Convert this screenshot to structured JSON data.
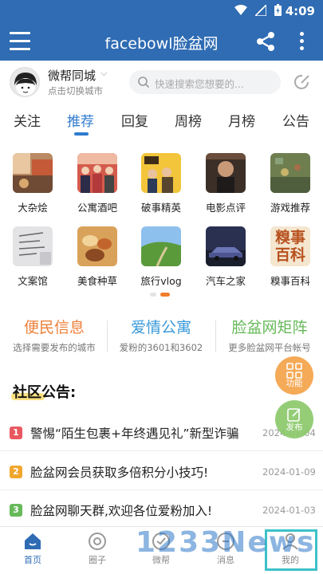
{
  "status_bar": {
    "time": "4:09",
    "icons": [
      "wifi-icon",
      "signal-icon",
      "battery-icon"
    ]
  },
  "app_bar": {
    "title": "facebowl脸盆网"
  },
  "user": {
    "city_name": "微帮同城",
    "city_hint": "点击切换城市"
  },
  "search": {
    "placeholder": "快速搜索您想要的..."
  },
  "tabs": [
    {
      "label": "关注",
      "active": false
    },
    {
      "label": "推荐",
      "active": true
    },
    {
      "label": "回复",
      "active": false
    },
    {
      "label": "周榜",
      "active": false
    },
    {
      "label": "月榜",
      "active": false
    },
    {
      "label": "公告",
      "active": false
    }
  ],
  "grid": [
    {
      "label": "大杂烩"
    },
    {
      "label": "公寓酒吧"
    },
    {
      "label": "破事精英"
    },
    {
      "label": "电影点评"
    },
    {
      "label": "游戏推荐"
    },
    {
      "label": "文案馆"
    },
    {
      "label": "美食种草"
    },
    {
      "label": "旅行vlog"
    },
    {
      "label": "汽车之家"
    },
    {
      "label": "糗事百科",
      "thumb_text": "糗事百科"
    }
  ],
  "promos": [
    {
      "title": "便民信息",
      "subtitle": "选择需要发布的城市",
      "color": "#ef7f3a"
    },
    {
      "title": "爱情公寓",
      "subtitle": "爱粉的3601和3602",
      "color": "#3a9ad9"
    },
    {
      "title": "脸盆网矩阵",
      "subtitle": "更多脸盆网平台帐号",
      "color": "#67b95a"
    }
  ],
  "section_title": "社区公告:",
  "notices": [
    {
      "num": "1",
      "text": "警惕“陌生包裹+年终遇见礼”新型诈骗",
      "date": "2024-01-04",
      "color": "#e8585f"
    },
    {
      "num": "2",
      "text": "脸盆网会员获取多倍积分小技巧!",
      "date": "2024-01-09",
      "color": "#f1a72e"
    },
    {
      "num": "3",
      "text": "脸盆网聊天群,欢迎各位爱粉加入!",
      "date": "2024-01-03",
      "color": "#67b95a"
    }
  ],
  "fabs": [
    {
      "label": "功能",
      "color": "#f5a34a"
    },
    {
      "label": "发布",
      "color": "#8cc96b"
    }
  ],
  "bottom_nav": [
    {
      "label": "首页",
      "active": true
    },
    {
      "label": "圈子",
      "active": false
    },
    {
      "label": "微帮",
      "active": false
    },
    {
      "label": "消息",
      "active": false
    },
    {
      "label": "我的",
      "active": false
    }
  ],
  "watermark": "1233News"
}
